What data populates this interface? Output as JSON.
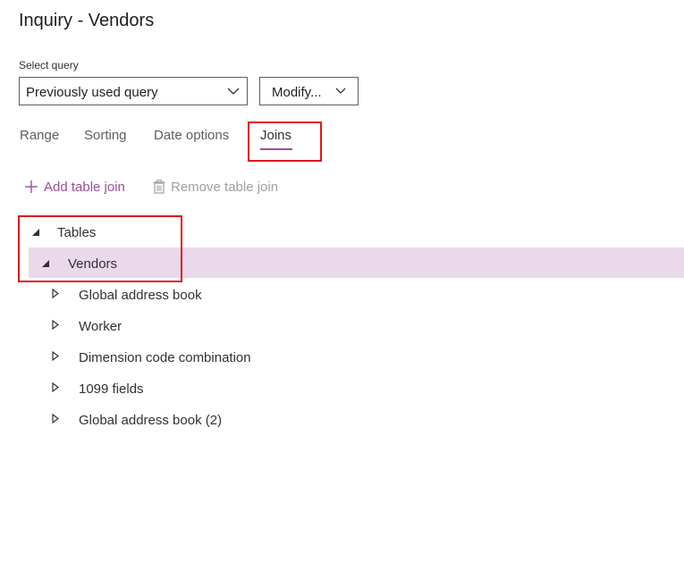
{
  "page": {
    "title": "Inquiry - Vendors"
  },
  "query": {
    "label": "Select query",
    "selected": "Previously used query",
    "modify_label": "Modify..."
  },
  "tabs": [
    {
      "label": "Range",
      "active": false
    },
    {
      "label": "Sorting",
      "active": false
    },
    {
      "label": "Date options",
      "active": false
    },
    {
      "label": "Joins",
      "active": true
    }
  ],
  "toolbar": {
    "add_label": "Add table join",
    "remove_label": "Remove table join"
  },
  "tree": {
    "root": "Tables",
    "selected_node": "Vendors",
    "children": [
      "Global address book",
      "Worker",
      "Dimension code combination",
      "1099 fields",
      "Global address book (2)"
    ]
  },
  "colors": {
    "accent": "#9b4f96",
    "selection": "#ead9ea",
    "highlight_box": "#e0161d"
  }
}
